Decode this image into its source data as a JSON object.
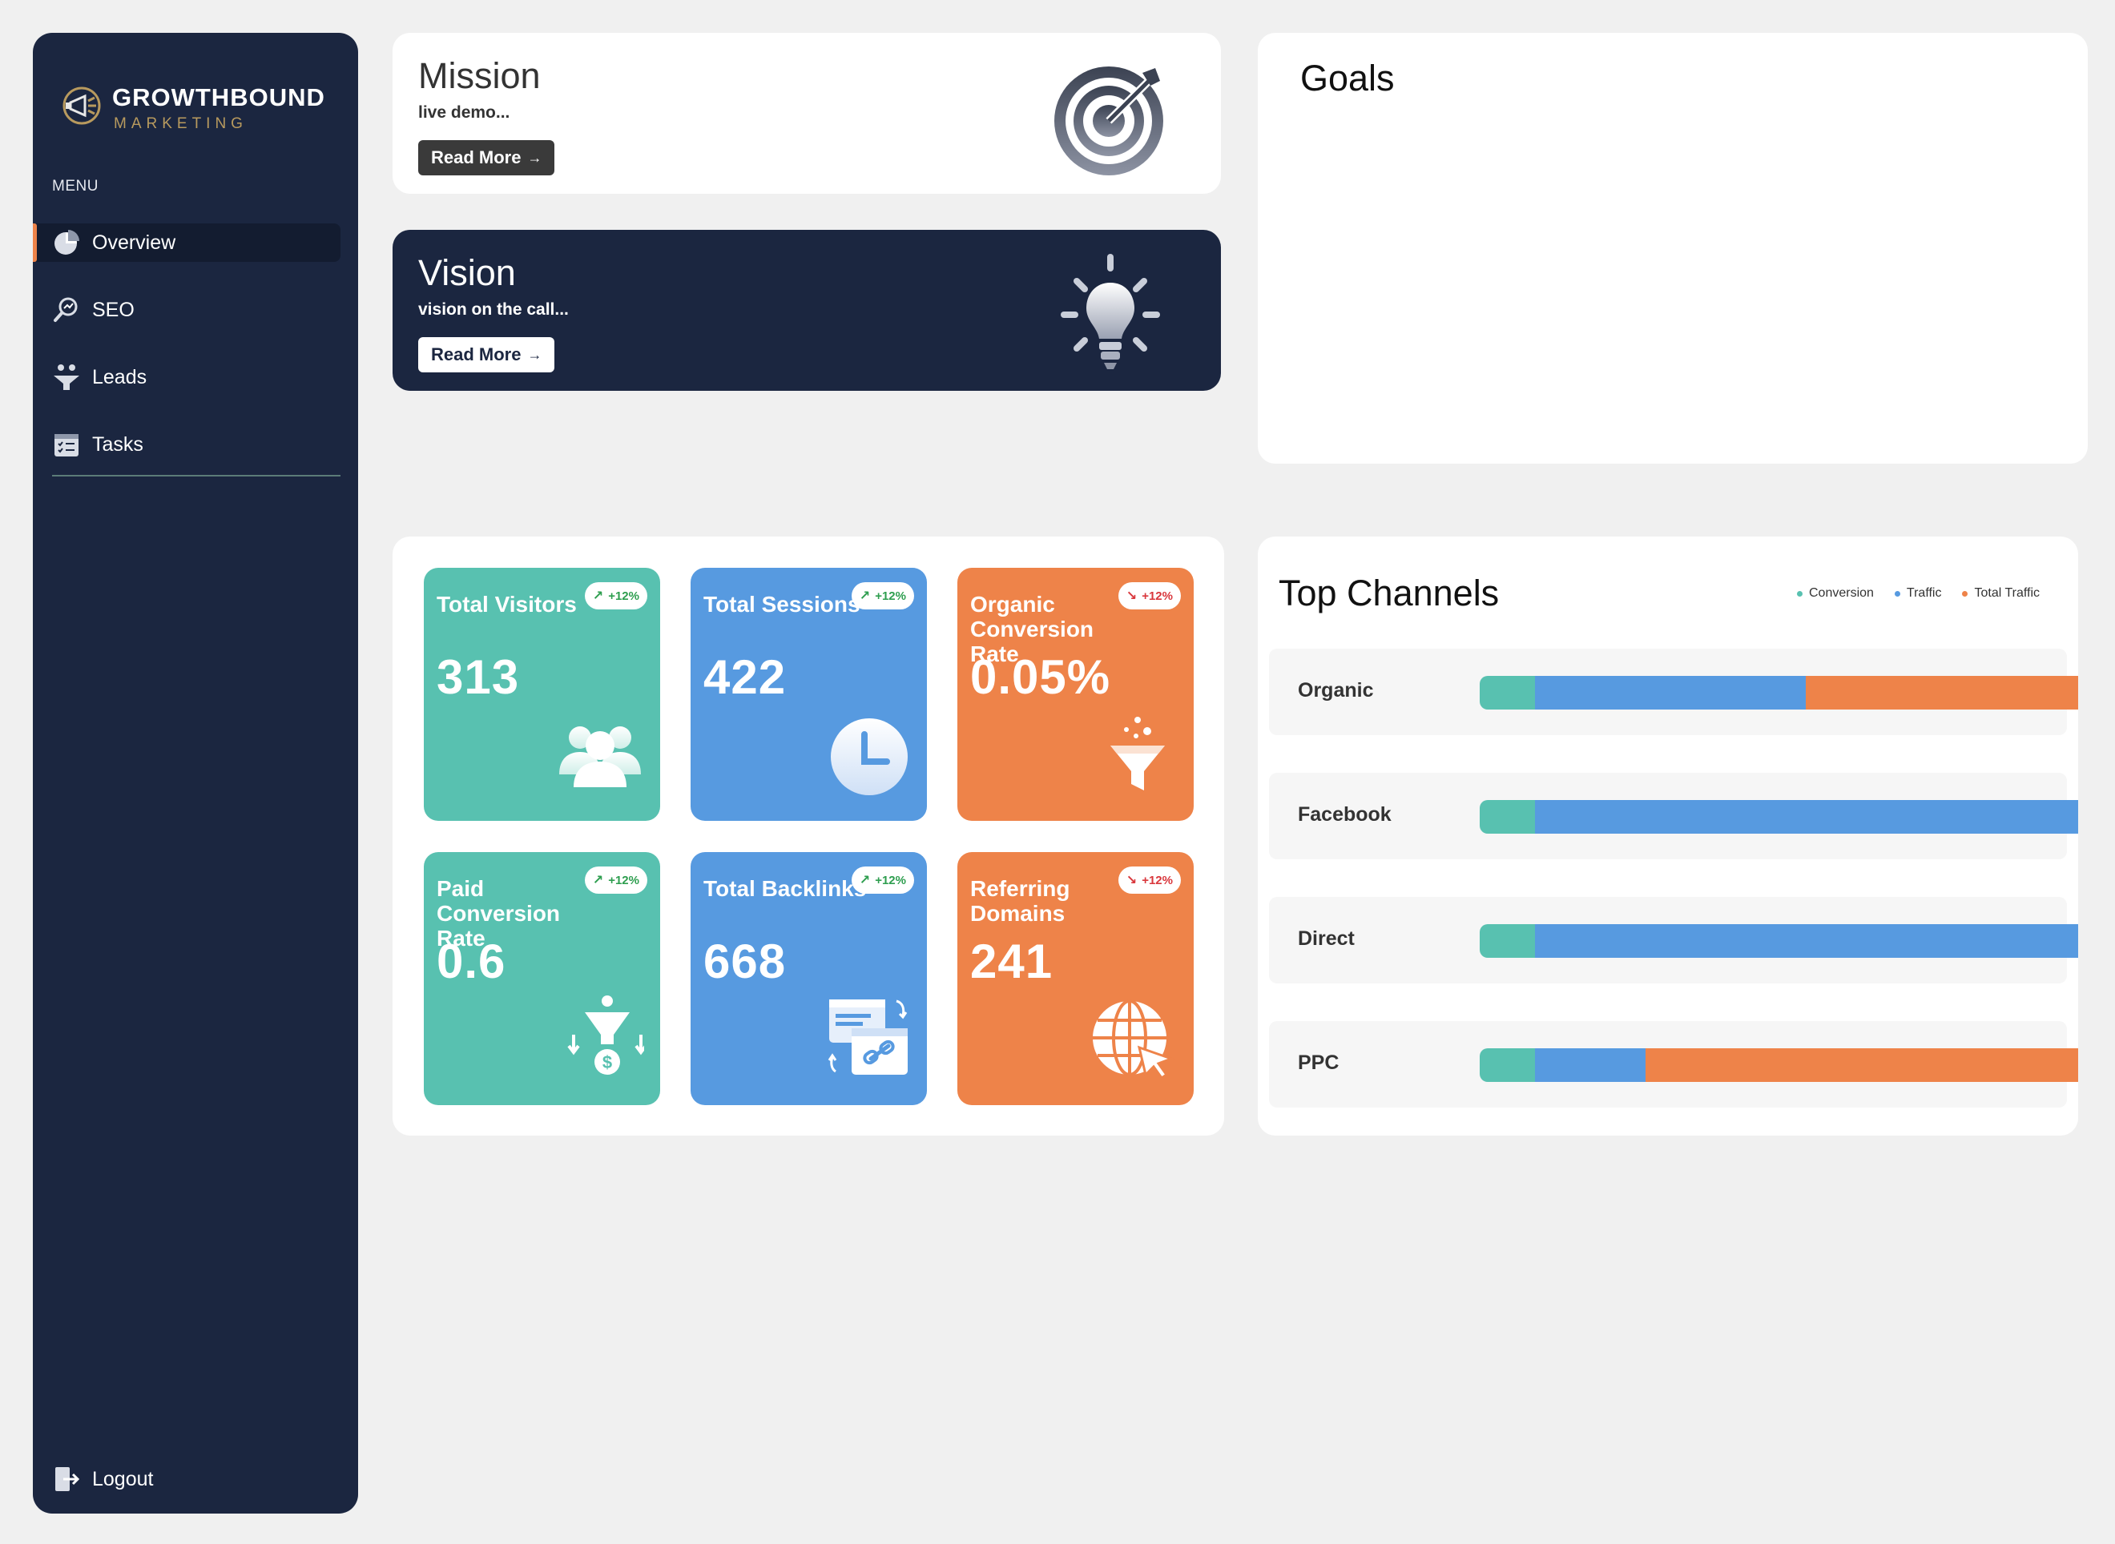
{
  "brand": {
    "name": "GROWTHBOUND",
    "sub": "MARKETING"
  },
  "sidebar": {
    "menu_label": "MENU",
    "items": [
      {
        "label": "Overview",
        "icon": "pie-chart-icon",
        "active": true
      },
      {
        "label": "SEO",
        "icon": "seo-search-icon",
        "active": false
      },
      {
        "label": "Leads",
        "icon": "leads-funnel-icon",
        "active": false
      },
      {
        "label": "Tasks",
        "icon": "tasks-checklist-icon",
        "active": false
      }
    ],
    "logout_label": "Logout"
  },
  "mission": {
    "title": "Mission",
    "text": "live demo...",
    "button": "Read More",
    "icon": "target-icon"
  },
  "vision": {
    "title": "Vision",
    "text": "vision on the call...",
    "button": "Read More",
    "icon": "lightbulb-icon"
  },
  "goals": {
    "title": "Goals"
  },
  "stats": [
    {
      "label": "Total Visitors",
      "value": "313",
      "badge": "+12%",
      "trend": "up",
      "color": "teal",
      "icon": "users-icon"
    },
    {
      "label": "Total Sessions",
      "value": "422",
      "badge": "+12%",
      "trend": "up",
      "color": "blue",
      "icon": "clock-icon"
    },
    {
      "label": "Organic Conversion Rate",
      "value": "0.05%",
      "badge": "+12%",
      "trend": "down",
      "color": "orange",
      "icon": "funnel-icon"
    },
    {
      "label": "Paid Conversion Rate",
      "value": "0.6",
      "badge": "+12%",
      "trend": "up",
      "color": "teal",
      "icon": "money-funnel-icon"
    },
    {
      "label": "Total Backlinks",
      "value": "668",
      "badge": "+12%",
      "trend": "up",
      "color": "blue",
      "icon": "backlinks-icon"
    },
    {
      "label": "Referring Domains",
      "value": "241",
      "badge": "+12%",
      "trend": "down",
      "color": "orange",
      "icon": "globe-cursor-icon"
    }
  ],
  "colors": {
    "teal": "#58c1b0",
    "blue": "#579ae0",
    "orange": "#ee8349",
    "navy": "#1b2640",
    "badge_green": "#2e9e4f",
    "badge_red": "#d9373c"
  },
  "top_channels": {
    "title": "Top Channels",
    "legend": [
      "Conversion",
      "Traffic",
      "Total Traffic"
    ],
    "rows": [
      {
        "name": "Organic",
        "conversion": 10,
        "traffic": 49,
        "total_traffic": 100
      },
      {
        "name": "Facebook",
        "conversion": 10,
        "traffic": 160,
        "total_traffic": 0
      },
      {
        "name": "Direct",
        "conversion": 10,
        "traffic": 160,
        "total_traffic": 0
      },
      {
        "name": "PPC",
        "conversion": 10,
        "traffic": 20,
        "total_traffic": 100
      }
    ]
  }
}
